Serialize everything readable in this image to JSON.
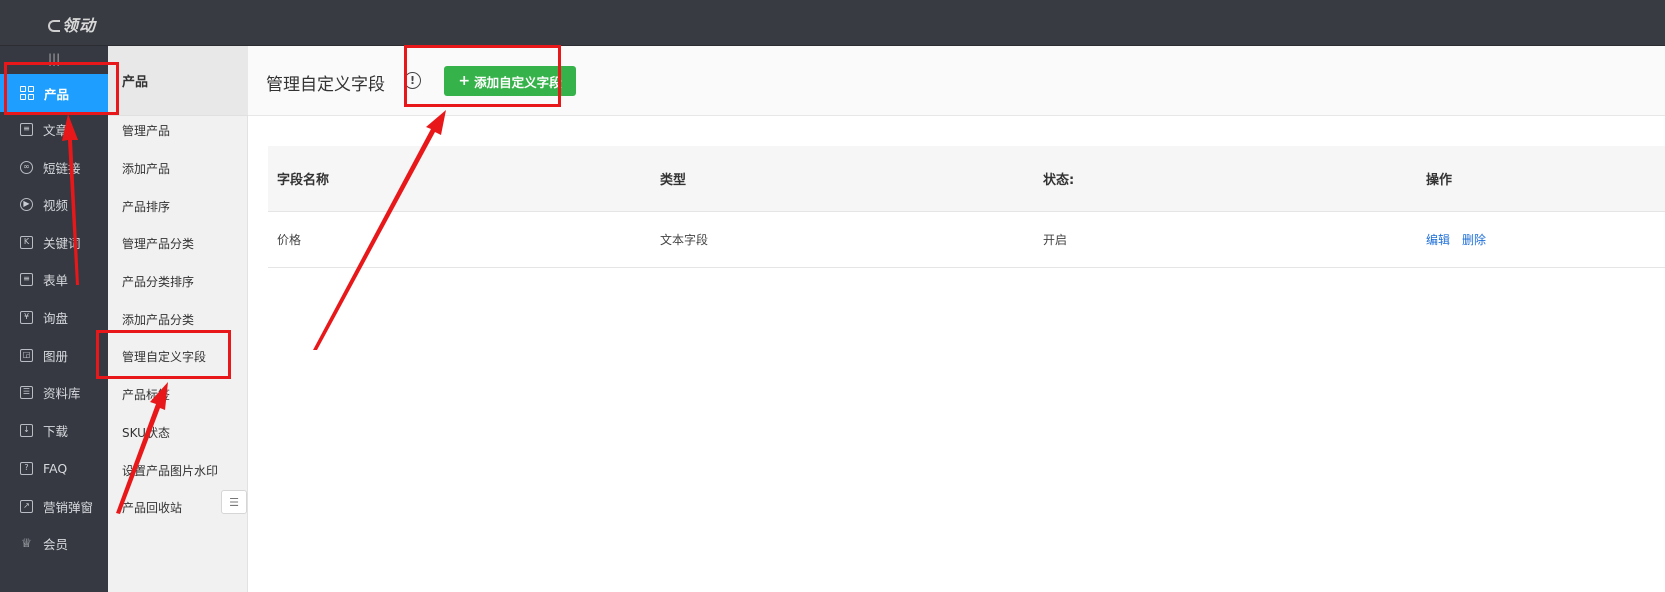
{
  "header": {
    "logo_text": "领动"
  },
  "rail": {
    "handle": "|||",
    "items": [
      {
        "label": "产品",
        "icon": "grid-icon",
        "active": true
      },
      {
        "label": "文章",
        "icon": "document-icon"
      },
      {
        "label": "短链接",
        "icon": "link-icon"
      },
      {
        "label": "视频",
        "icon": "play-icon"
      },
      {
        "label": "关键词",
        "icon": "keyword-icon"
      },
      {
        "label": "表单",
        "icon": "clipboard-icon"
      },
      {
        "label": "询盘",
        "icon": "inquiry-icon"
      },
      {
        "label": "图册",
        "icon": "album-icon"
      },
      {
        "label": "资料库",
        "icon": "library-icon"
      },
      {
        "label": "下载",
        "icon": "download-icon"
      },
      {
        "label": "FAQ",
        "icon": "question-icon"
      },
      {
        "label": "营销弹窗",
        "icon": "popup-icon"
      },
      {
        "label": "会员",
        "icon": "crown-icon"
      }
    ]
  },
  "subnav": {
    "title": "产品",
    "items": [
      "管理产品",
      "添加产品",
      "产品排序",
      "管理产品分类",
      "产品分类排序",
      "添加产品分类",
      "管理自定义字段",
      "产品标签",
      "SKU状态",
      "设置产品图片水印",
      "产品回收站"
    ]
  },
  "main": {
    "title": "管理自定义字段",
    "info_icon": "!",
    "add_button": {
      "icon": "+",
      "label": "添加自定义字段"
    }
  },
  "table": {
    "headers": [
      "字段名称",
      "类型",
      "状态:",
      "操作"
    ],
    "rows": [
      {
        "name": "价格",
        "type": "文本字段",
        "status": "开启",
        "edit": "编辑",
        "delete": "删除"
      }
    ]
  },
  "colors": {
    "topbar": "#383b42",
    "rail": "#363941",
    "active": "#1e9fff",
    "add_button": "#35b34a",
    "link": "#1e6fd9",
    "annotation": "#e8181a"
  }
}
